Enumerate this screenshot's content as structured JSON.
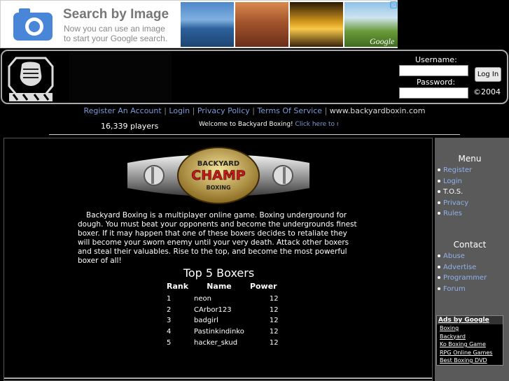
{
  "ad": {
    "title": "Search by Image",
    "line1": "Now you can use an image",
    "line2": "to start your Google search.",
    "brand": "Google",
    "choices_icon": "adchoices-icon",
    "camera_icon": "camera-icon"
  },
  "header": {
    "username_label": "Username:",
    "password_label": "Password:",
    "login_button": "Log In",
    "copyright": "©2004",
    "logo_icon": "boxer-fist-logo-icon"
  },
  "nav": {
    "items": [
      "Register An Account",
      "Login",
      "Privacy Policy",
      "Terms Of Service"
    ],
    "separator": "|",
    "domain": "www.backyardboxin.com"
  },
  "stats": {
    "players": "16,339 players",
    "welcome_text": "Welcome to Backyard Boxing!",
    "welcome_link": "Click here to r"
  },
  "belt": {
    "line1": "BACKYARD",
    "line2": "CHAMP",
    "line3": "BOXING"
  },
  "main": {
    "intro": "Backyard Boxing is a multiplayer online game. Boxing underground for dough. You must beat your opponents and become the undergrounds finest boxer. If it may happen that one of these boxers decides to retaliate they will become your sworn enemy until your very death. Attack other boxers and steal their valuables. Rise to the top, and become the most powerful boxer of all!",
    "top5_title": "Top 5 Boxers",
    "table_headers": [
      "Rank",
      "Name",
      "Power"
    ],
    "boxers": [
      {
        "rank": "1",
        "name": "neon",
        "power": "12"
      },
      {
        "rank": "2",
        "name": "CArbor123",
        "power": "12"
      },
      {
        "rank": "3",
        "name": "badgirl",
        "power": "12"
      },
      {
        "rank": "4",
        "name": "Pastinkindinko",
        "power": "12"
      },
      {
        "rank": "5",
        "name": "hacker_skud",
        "power": "12"
      }
    ]
  },
  "sidebar": {
    "menu_heading": "Menu",
    "menu_items": [
      "Register",
      "Login",
      "T.O.S.",
      "Privacy",
      "Rules"
    ],
    "contact_heading": "Contact",
    "contact_items": [
      "Abuse",
      "Advertise",
      "Programmer",
      "Forum"
    ],
    "ads_heading": "Ads by Google",
    "ads_items": [
      "Boxing",
      "Backyard",
      "Ko Boxing Game",
      "RPG Online Games",
      "Best Boxing DVD"
    ]
  },
  "colors": {
    "link": "#7a9cd6",
    "sidebar_bg": "#5a5a5a",
    "sidebar_link": "#8fb2ef"
  }
}
